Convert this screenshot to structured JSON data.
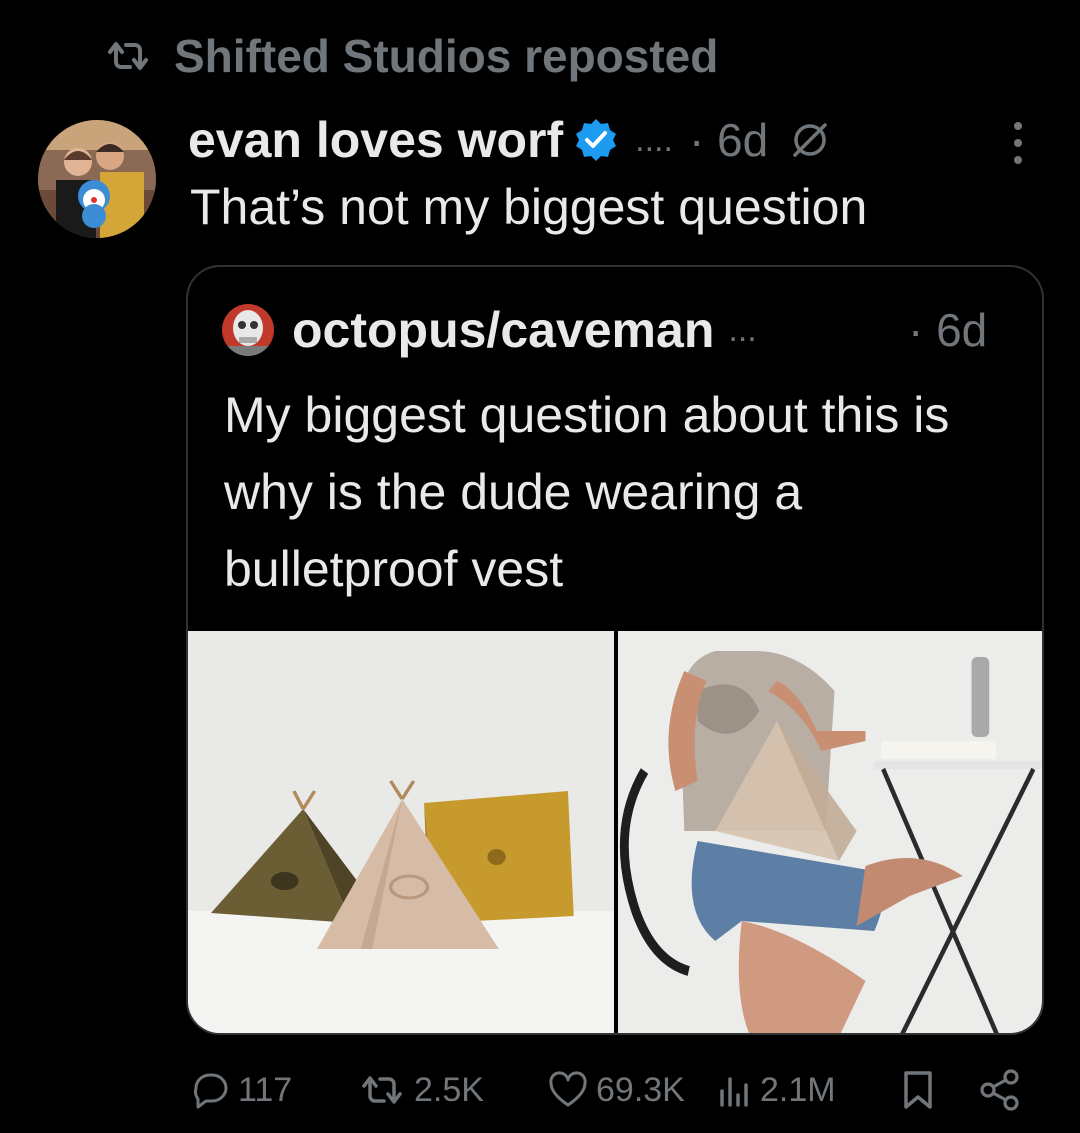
{
  "repost": {
    "label": "Shifted Studios reposted"
  },
  "post": {
    "author": "evan loves worf",
    "more_indicator": "....",
    "time": "· 6d",
    "text": "That’s not my biggest question"
  },
  "quote": {
    "author": "octopus/caveman",
    "more_indicator": "...",
    "time": "· 6d",
    "text": "My biggest question about this is why is the dude wearing a bulletproof vest"
  },
  "actions": {
    "replies": "117",
    "reposts": "2.5K",
    "likes": "69.3K",
    "views": "2.1M"
  },
  "colors": {
    "accent": "#1d9bf0",
    "muted": "#71767b",
    "text": "#e7e9ea",
    "background": "#000000"
  },
  "icons": [
    "repost-icon",
    "verified-badge-icon",
    "replies-restricted-icon",
    "more-icon",
    "reply-icon",
    "like-icon",
    "views-icon",
    "bookmark-icon",
    "share-icon"
  ]
}
